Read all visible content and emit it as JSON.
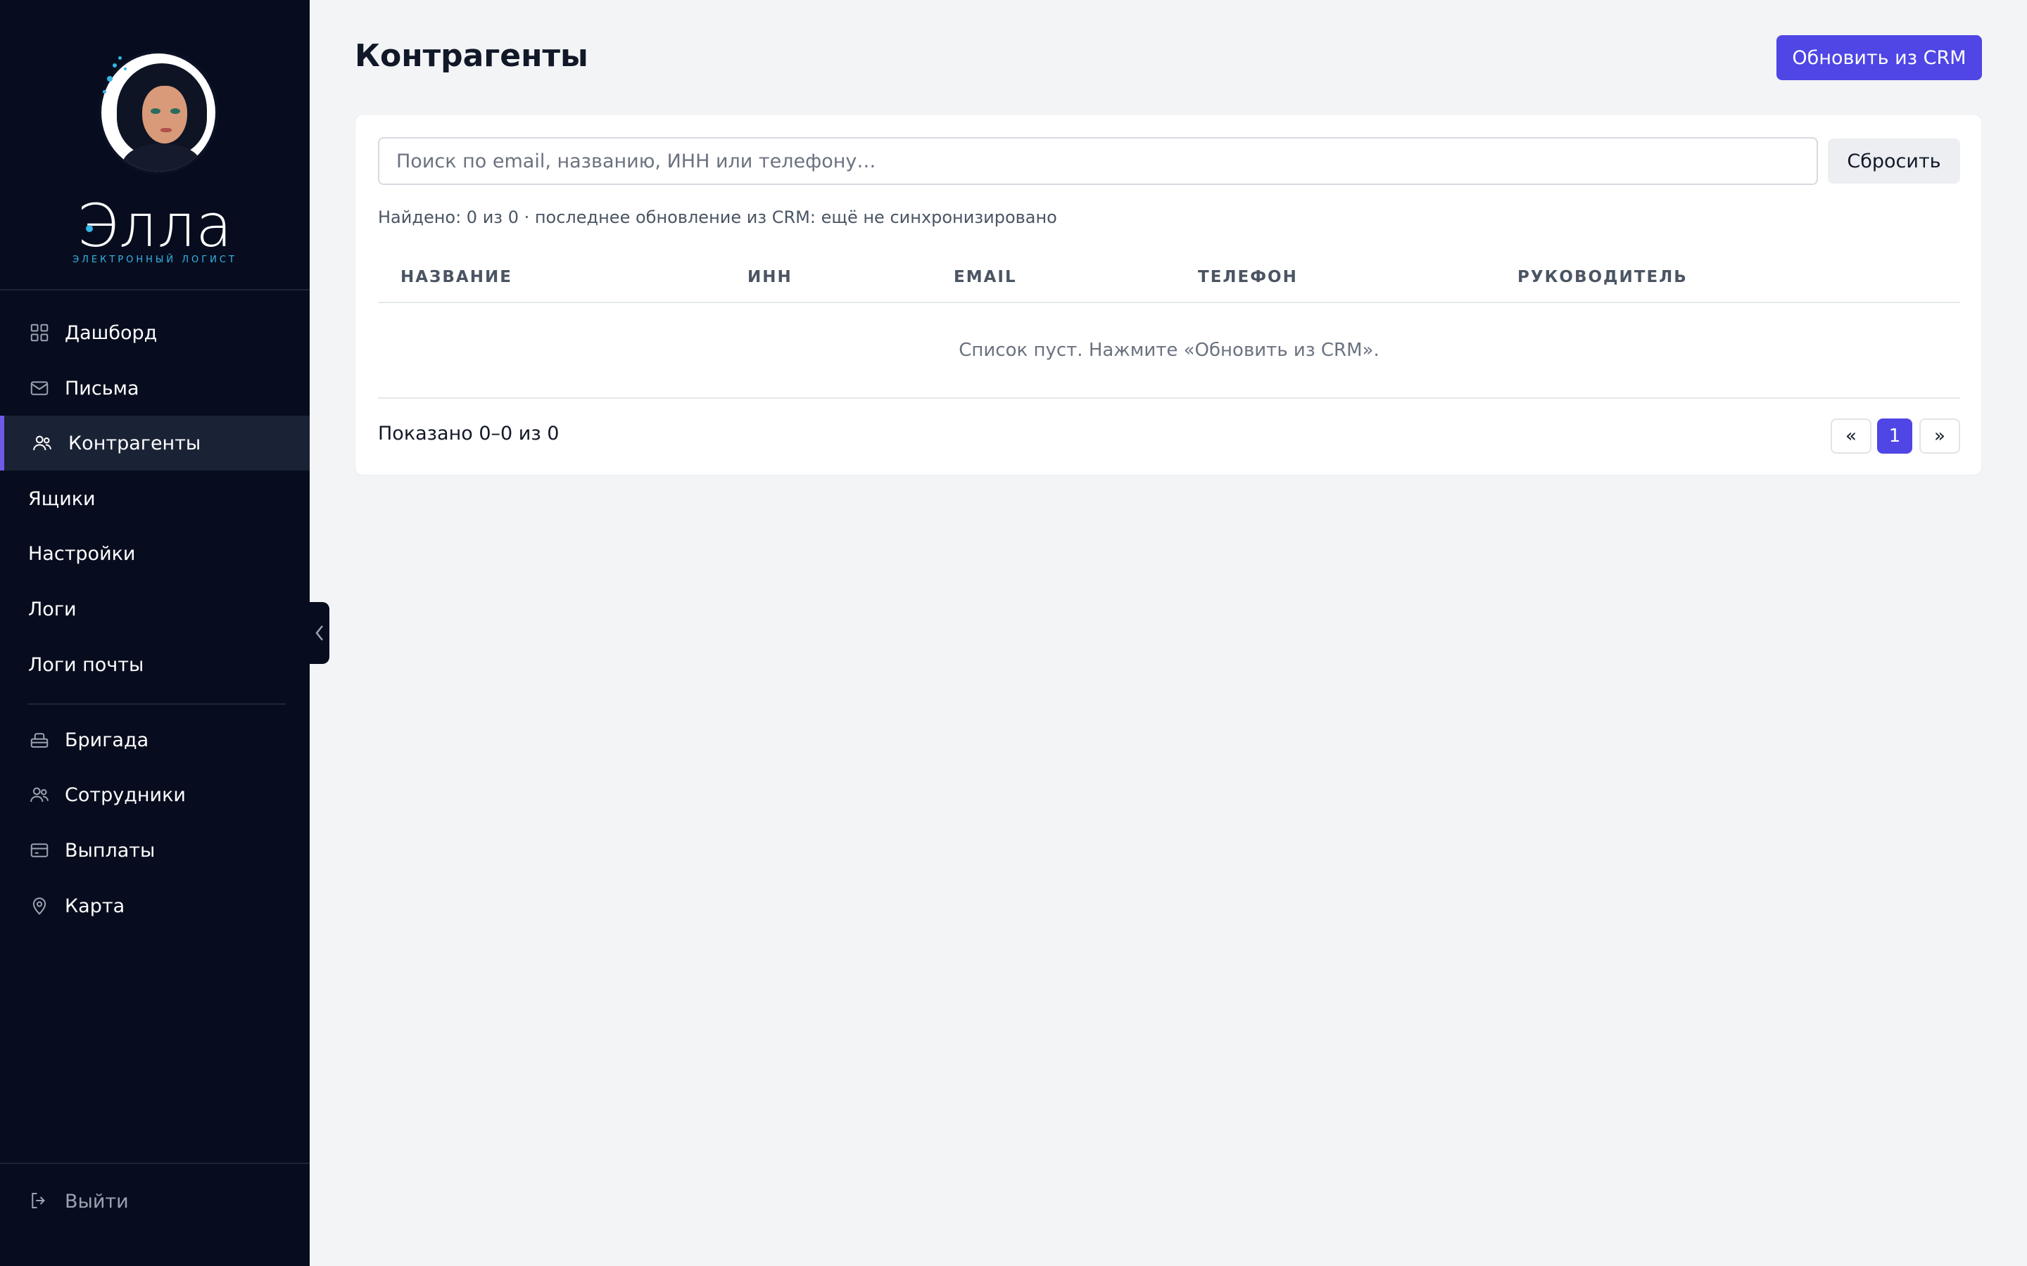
{
  "brand": {
    "name": "Элла",
    "subtitle": "ЭЛЕКТРОННЫЙ ЛОГИСТ"
  },
  "sidebar": {
    "items": [
      {
        "label": "Дашборд",
        "icon": "dashboard-icon"
      },
      {
        "label": "Письма",
        "icon": "mail-icon"
      },
      {
        "label": "Контрагенты",
        "icon": "users-icon",
        "active": true
      },
      {
        "label": "Ящики"
      },
      {
        "label": "Настройки"
      },
      {
        "label": "Логи"
      },
      {
        "label": "Логи почты"
      },
      {
        "label": "Бригада",
        "icon": "toolbox-icon"
      },
      {
        "label": "Сотрудники",
        "icon": "employees-icon"
      },
      {
        "label": "Выплаты",
        "icon": "card-icon"
      },
      {
        "label": "Карта",
        "icon": "map-pin-icon"
      }
    ],
    "logout_label": "Выйти"
  },
  "header": {
    "title": "Контрагенты",
    "crm_button_label": "Обновить из CRM"
  },
  "search": {
    "placeholder": "Поиск по email, названию, ИНН или телефону…",
    "value": "",
    "reset_label": "Сбросить"
  },
  "summary": "Найдено: 0 из 0 · последнее обновление из CRM: ещё не синхронизировано",
  "table": {
    "columns": [
      "НАЗВАНИЕ",
      "ИНН",
      "EMAIL",
      "ТЕЛЕФОН",
      "РУКОВОДИТЕЛЬ"
    ],
    "rows": [],
    "empty_text": "Список пуст. Нажмите «Обновить из CRM»."
  },
  "pagination": {
    "shown_text": "Показано 0–0 из 0",
    "prev_label": "«",
    "current_page": "1",
    "next_label": "»"
  },
  "colors": {
    "sidebar_bg": "#070d1e",
    "accent": "#4f46e5",
    "active_marker": "#6d5be8",
    "brand_cyan": "#36b5e6",
    "page_bg": "#f3f4f6"
  }
}
